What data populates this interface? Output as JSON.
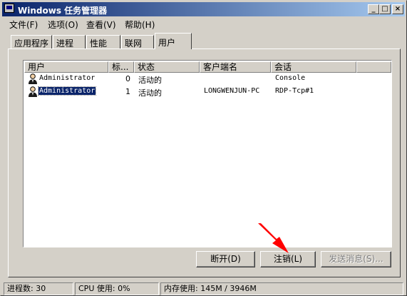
{
  "window": {
    "title": "Windows 任务管理器"
  },
  "title_buttons": {
    "minimize": "_",
    "maximize": "□",
    "close": "×"
  },
  "menu": [
    "文件(F)",
    "选项(O)",
    "查看(V)",
    "帮助(H)"
  ],
  "tabs": [
    "应用程序",
    "进程",
    "性能",
    "联网",
    "用户"
  ],
  "active_tab": "用户",
  "columns": [
    "用户",
    "标识",
    "状态",
    "客户端名",
    "会话"
  ],
  "column_header_display": [
    "用户",
    "标...",
    "状态",
    "客户端名",
    "会话"
  ],
  "users": [
    {
      "user": "Administrator",
      "id": "0",
      "status": "活动的",
      "client": "",
      "session": "Console",
      "selected": false
    },
    {
      "user": "Administrator",
      "id": "1",
      "status": "活动的",
      "client": "LONGWENJUN-PC",
      "session": "RDP-Tcp#1",
      "selected": true
    }
  ],
  "buttons": {
    "disconnect": "断开(D)",
    "logoff": "注销(L)",
    "send_message": "发送消息(S)..."
  },
  "status_bar": {
    "processes": "进程数: 30",
    "cpu": "CPU 使用: 0%",
    "memory": "内存使用: 145M / 3946M"
  },
  "colors": {
    "titlebar_start": "#0a246a",
    "titlebar_end": "#a6caf0",
    "selection": "#0a246a",
    "annotation_arrow": "#ff0000"
  },
  "icons": [
    "app-icon",
    "user-icon",
    "annotation-arrow-icon"
  ]
}
